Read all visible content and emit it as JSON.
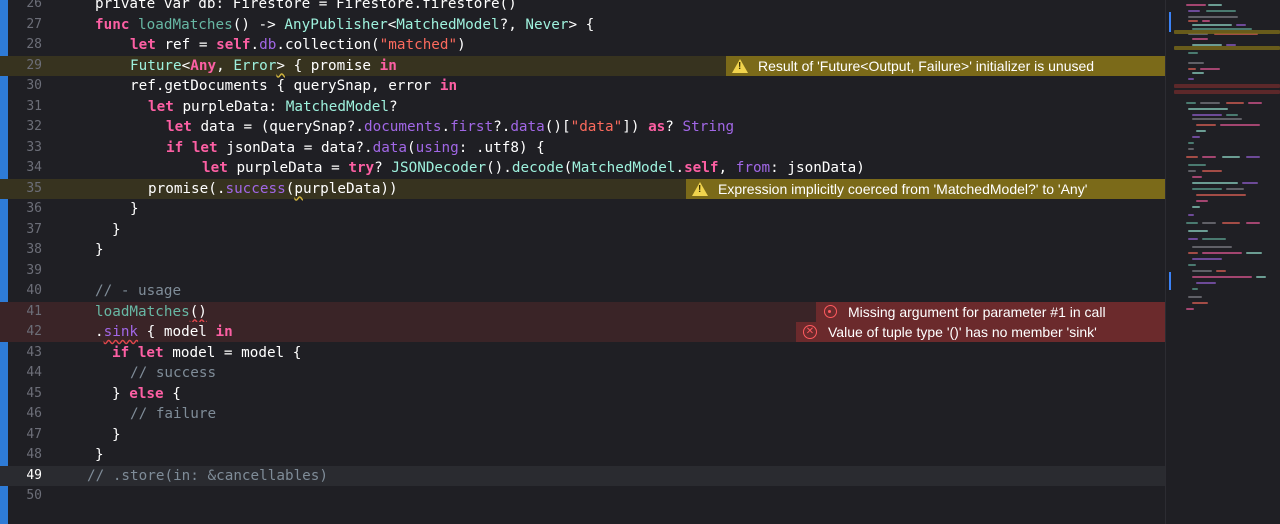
{
  "editor": {
    "lines": [
      {
        "num": "26",
        "tokens": [
          {
            "t": "private var db: Firestore = Firestore.firestore()",
            "c": "pl"
          }
        ]
      },
      {
        "num": "27",
        "tokens": [
          {
            "t": "func ",
            "c": "kw"
          },
          {
            "t": "loadMatches",
            "c": "fn"
          },
          {
            "t": "() -> ",
            "c": "pl"
          },
          {
            "t": "AnyPublisher",
            "c": "ty"
          },
          {
            "t": "<",
            "c": "pl"
          },
          {
            "t": "MatchedModel",
            "c": "ty"
          },
          {
            "t": "?, ",
            "c": "pl"
          },
          {
            "t": "Never",
            "c": "ty"
          },
          {
            "t": "> {",
            "c": "pl"
          }
        ]
      },
      {
        "num": "28",
        "tokens": [
          {
            "t": "let ",
            "c": "kw"
          },
          {
            "t": "ref = ",
            "c": "pl"
          },
          {
            "t": "self",
            "c": "kw"
          },
          {
            "t": ".",
            "c": "pl"
          },
          {
            "t": "db",
            "c": "pr"
          },
          {
            "t": ".collection(",
            "c": "pl"
          },
          {
            "t": "\"matched\"",
            "c": "st"
          },
          {
            "t": ")",
            "c": "pl"
          }
        ]
      },
      {
        "num": "29",
        "tokens": [
          {
            "t": "Future",
            "c": "ty"
          },
          {
            "t": "<",
            "c": "pl"
          },
          {
            "t": "Any",
            "c": "kw"
          },
          {
            "t": ", ",
            "c": "pl"
          },
          {
            "t": "Error",
            "c": "ty"
          },
          {
            "t": ">",
            "c": "pl",
            "u": "y"
          },
          {
            "t": " { promise ",
            "c": "pl"
          },
          {
            "t": "in",
            "c": "kw"
          }
        ]
      },
      {
        "num": "30",
        "tokens": [
          {
            "t": "ref.getDocuments { querySnap, error ",
            "c": "pl"
          },
          {
            "t": "in",
            "c": "kw"
          }
        ]
      },
      {
        "num": "31",
        "tokens": [
          {
            "t": "let ",
            "c": "kw"
          },
          {
            "t": "purpleData: ",
            "c": "pl"
          },
          {
            "t": "MatchedModel",
            "c": "ty"
          },
          {
            "t": "?",
            "c": "pl"
          }
        ]
      },
      {
        "num": "32",
        "tokens": [
          {
            "t": "let ",
            "c": "kw"
          },
          {
            "t": "data = (querySnap?.",
            "c": "pl"
          },
          {
            "t": "documents",
            "c": "pr"
          },
          {
            "t": ".",
            "c": "pl"
          },
          {
            "t": "first",
            "c": "pr"
          },
          {
            "t": "?.",
            "c": "pl"
          },
          {
            "t": "data",
            "c": "pr"
          },
          {
            "t": "()[",
            "c": "pl"
          },
          {
            "t": "\"data\"",
            "c": "st"
          },
          {
            "t": "]) ",
            "c": "pl"
          },
          {
            "t": "as",
            "c": "kw"
          },
          {
            "t": "? ",
            "c": "pl"
          },
          {
            "t": "String",
            "c": "pr"
          }
        ]
      },
      {
        "num": "33",
        "tokens": [
          {
            "t": "if let ",
            "c": "kw"
          },
          {
            "t": "jsonData = data?.",
            "c": "pl"
          },
          {
            "t": "data",
            "c": "pr"
          },
          {
            "t": "(",
            "c": "pl"
          },
          {
            "t": "using",
            "c": "pr"
          },
          {
            "t": ": .utf8) {",
            "c": "pl"
          }
        ]
      },
      {
        "num": "34",
        "tokens": [
          {
            "t": "let ",
            "c": "kw"
          },
          {
            "t": "purpleData = ",
            "c": "pl"
          },
          {
            "t": "try",
            "c": "kw"
          },
          {
            "t": "? ",
            "c": "pl"
          },
          {
            "t": "JSONDecoder",
            "c": "ty"
          },
          {
            "t": "().",
            "c": "pl"
          },
          {
            "t": "decode",
            "c": "ty"
          },
          {
            "t": "(",
            "c": "pl"
          },
          {
            "t": "MatchedModel",
            "c": "ty"
          },
          {
            "t": ".",
            "c": "pl"
          },
          {
            "t": "self",
            "c": "kw"
          },
          {
            "t": ", ",
            "c": "pl"
          },
          {
            "t": "from",
            "c": "pr"
          },
          {
            "t": ": jsonData)",
            "c": "pl"
          }
        ]
      },
      {
        "num": "35",
        "tokens": [
          {
            "t": "promise(.",
            "c": "pl"
          },
          {
            "t": "success",
            "c": "pr"
          },
          {
            "t": "(",
            "c": "pl"
          },
          {
            "t": "p",
            "c": "pl",
            "u": "y"
          },
          {
            "t": "urpleData))",
            "c": "pl"
          }
        ]
      },
      {
        "num": "36",
        "tokens": [
          {
            "t": "}",
            "c": "pl"
          }
        ]
      },
      {
        "num": "37",
        "tokens": [
          {
            "t": "}",
            "c": "pl"
          }
        ]
      },
      {
        "num": "38",
        "tokens": [
          {
            "t": "}",
            "c": "pl"
          }
        ]
      },
      {
        "num": "39",
        "tokens": []
      },
      {
        "num": "40",
        "tokens": [
          {
            "t": "// - usage",
            "c": "cm"
          }
        ]
      },
      {
        "num": "41",
        "tokens": [
          {
            "t": "loadMatches",
            "c": "fn"
          },
          {
            "t": "()",
            "c": "pl",
            "u": "r"
          }
        ]
      },
      {
        "num": "42",
        "tokens": [
          {
            "t": ".",
            "c": "pl"
          },
          {
            "t": "sink",
            "c": "pr",
            "u": "r"
          },
          {
            "t": " { model ",
            "c": "pl"
          },
          {
            "t": "in",
            "c": "kw"
          }
        ]
      },
      {
        "num": "43",
        "tokens": [
          {
            "t": "if let ",
            "c": "kw"
          },
          {
            "t": "model = model {",
            "c": "pl"
          }
        ]
      },
      {
        "num": "44",
        "tokens": [
          {
            "t": "// success",
            "c": "cm"
          }
        ]
      },
      {
        "num": "45",
        "tokens": [
          {
            "t": "} ",
            "c": "pl"
          },
          {
            "t": "else",
            "c": "kw"
          },
          {
            "t": " {",
            "c": "pl"
          }
        ]
      },
      {
        "num": "46",
        "tokens": [
          {
            "t": "// failure",
            "c": "cm"
          }
        ]
      },
      {
        "num": "47",
        "tokens": [
          {
            "t": "}",
            "c": "pl"
          }
        ]
      },
      {
        "num": "48",
        "tokens": [
          {
            "t": "}",
            "c": "pl"
          }
        ]
      },
      {
        "num": "49",
        "tokens": [
          {
            "t": "// .store(in: &cancellables)",
            "c": "cm"
          }
        ]
      },
      {
        "num": "50",
        "tokens": []
      }
    ],
    "diagnostics": [
      {
        "line": "29",
        "kind": "warning",
        "icon": "warning-icon",
        "message": "Result of 'Future<Output, Failure>' initializer is unused"
      },
      {
        "line": "35",
        "kind": "warning",
        "icon": "warning-icon",
        "message": "Expression implicitly coerced from 'MatchedModel?' to 'Any'"
      },
      {
        "line": "41",
        "kind": "error",
        "icon": "error-circle-icon",
        "message": "Missing argument for parameter #1 in call"
      },
      {
        "line": "42",
        "kind": "error",
        "icon": "error-x-icon",
        "message": "Value of tuple type '()' has no member 'sink'"
      }
    ]
  },
  "colors": {
    "background": "#1f1f24",
    "keyword": "#fc5fa3",
    "type": "#9ef1dd",
    "function": "#67b7a4",
    "property": "#a167e6",
    "string": "#fc6a5d",
    "comment": "#7f8c98",
    "warning_banner": "#7b6a19",
    "error_banner": "#6b2a2c",
    "change_bar": "#2e7bd6"
  }
}
